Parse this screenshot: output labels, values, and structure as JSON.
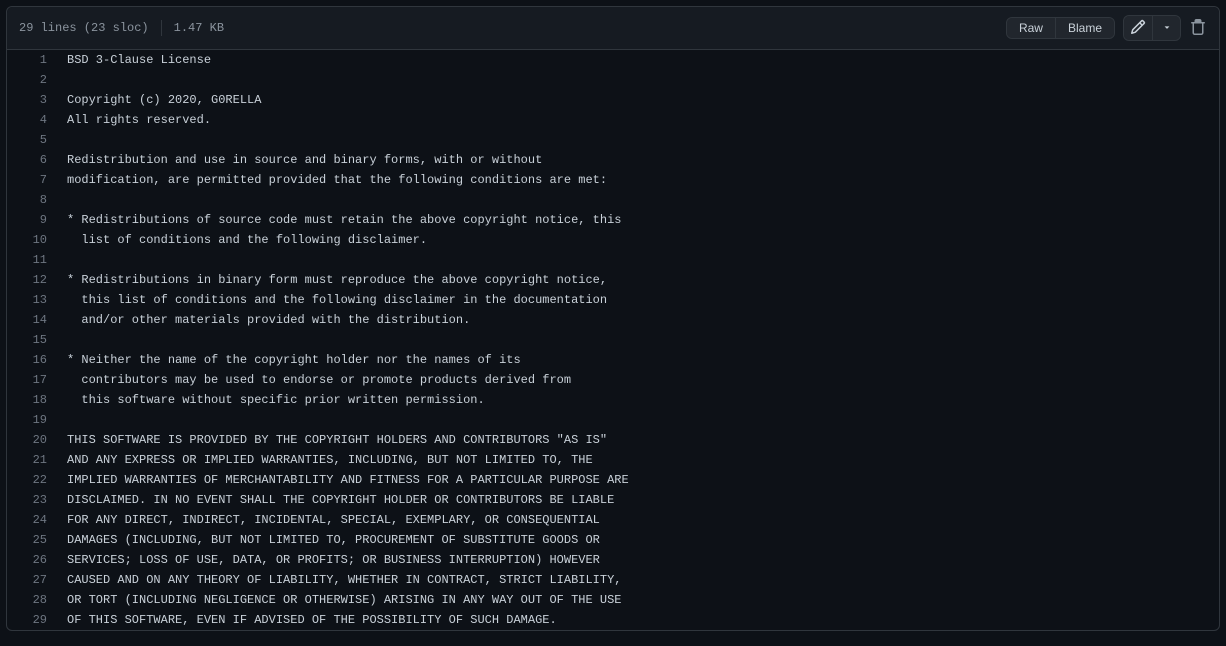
{
  "header": {
    "lines_text": "29 lines (23 sloc)",
    "size_text": "1.47 KB",
    "raw_label": "Raw",
    "blame_label": "Blame"
  },
  "code": {
    "lines": [
      "BSD 3-Clause License",
      "",
      "Copyright (c) 2020, G0RELLA",
      "All rights reserved.",
      "",
      "Redistribution and use in source and binary forms, with or without",
      "modification, are permitted provided that the following conditions are met:",
      "",
      "* Redistributions of source code must retain the above copyright notice, this",
      "  list of conditions and the following disclaimer.",
      "",
      "* Redistributions in binary form must reproduce the above copyright notice,",
      "  this list of conditions and the following disclaimer in the documentation",
      "  and/or other materials provided with the distribution.",
      "",
      "* Neither the name of the copyright holder nor the names of its",
      "  contributors may be used to endorse or promote products derived from",
      "  this software without specific prior written permission.",
      "",
      "THIS SOFTWARE IS PROVIDED BY THE COPYRIGHT HOLDERS AND CONTRIBUTORS \"AS IS\"",
      "AND ANY EXPRESS OR IMPLIED WARRANTIES, INCLUDING, BUT NOT LIMITED TO, THE",
      "IMPLIED WARRANTIES OF MERCHANTABILITY AND FITNESS FOR A PARTICULAR PURPOSE ARE",
      "DISCLAIMED. IN NO EVENT SHALL THE COPYRIGHT HOLDER OR CONTRIBUTORS BE LIABLE",
      "FOR ANY DIRECT, INDIRECT, INCIDENTAL, SPECIAL, EXEMPLARY, OR CONSEQUENTIAL",
      "DAMAGES (INCLUDING, BUT NOT LIMITED TO, PROCUREMENT OF SUBSTITUTE GOODS OR",
      "SERVICES; LOSS OF USE, DATA, OR PROFITS; OR BUSINESS INTERRUPTION) HOWEVER",
      "CAUSED AND ON ANY THEORY OF LIABILITY, WHETHER IN CONTRACT, STRICT LIABILITY,",
      "OR TORT (INCLUDING NEGLIGENCE OR OTHERWISE) ARISING IN ANY WAY OUT OF THE USE",
      "OF THIS SOFTWARE, EVEN IF ADVISED OF THE POSSIBILITY OF SUCH DAMAGE."
    ]
  }
}
